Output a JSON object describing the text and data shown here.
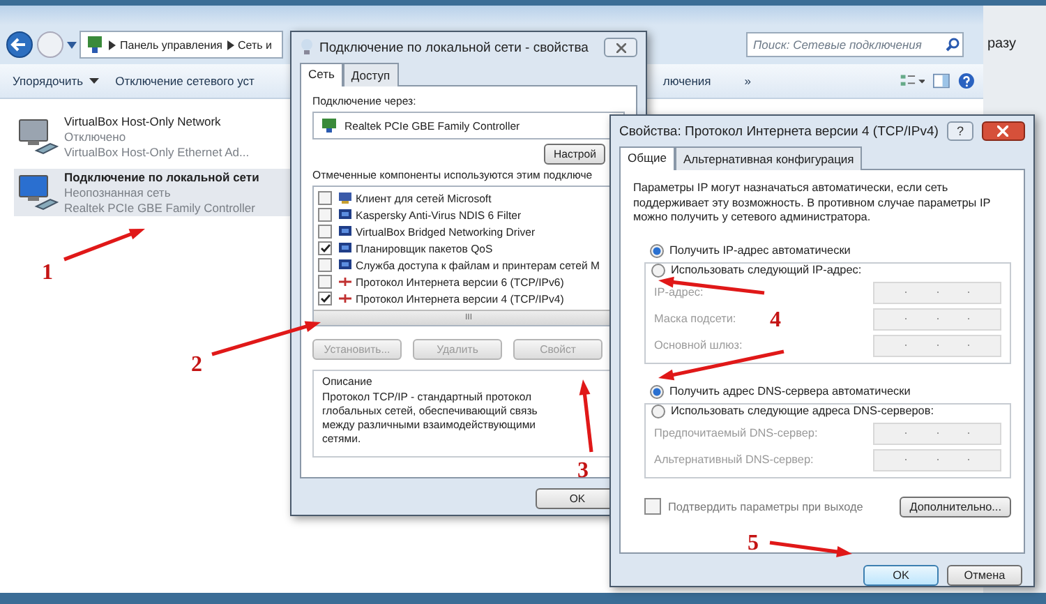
{
  "explorer": {
    "breadcrumb": [
      "Панель управления",
      "Сеть и"
    ],
    "search": {
      "placeholder": "Поиск: Сетевые подключения"
    },
    "toolbar": [
      {
        "label": "Упорядочить",
        "kind": "menu"
      },
      {
        "label": "Отключение сетевого уст",
        "kind": "plain"
      }
    ],
    "toolbar_right": "лючения",
    "toolbar_more": "»",
    "connections": [
      {
        "name": "VirtualBox Host-Only Network",
        "status": "Отключено",
        "device": "VirtualBox Host-Only Ethernet Ad...",
        "selected": false
      },
      {
        "name": "Подключение по локальной сети",
        "status": "Неопознанная сеть",
        "device": "Realtek PCIe GBE Family Controller",
        "selected": true
      }
    ]
  },
  "side_window": {
    "text": "разу"
  },
  "lan_dialog": {
    "title": "Подключение по локальной сети - свойства",
    "tabs": [
      {
        "label": "Сеть",
        "selected": true
      },
      {
        "label": "Доступ",
        "selected": false
      }
    ],
    "via_label": "Подключение через:",
    "adapter": "Realtek PCIe GBE Family Controller",
    "configure_button": "Настрой",
    "components_label": "Отмеченные компоненты используются этим подключе",
    "components": [
      {
        "label": "Клиент для сетей Microsoft",
        "checked": false,
        "kind": "client"
      },
      {
        "label": "Kaspersky Anti-Virus NDIS 6 Filter",
        "checked": false,
        "kind": "service"
      },
      {
        "label": "VirtualBox Bridged Networking Driver",
        "checked": false,
        "kind": "service"
      },
      {
        "label": "Планировщик пакетов QoS",
        "checked": true,
        "kind": "service"
      },
      {
        "label": "Служба доступа к файлам и принтерам сетей M",
        "checked": false,
        "kind": "service"
      },
      {
        "label": "Протокол Интернета версии 6 (TCP/IPv6)",
        "checked": false,
        "kind": "protocol"
      },
      {
        "label": "Протокол Интернета версии 4 (TCP/IPv4)",
        "checked": true,
        "kind": "protocol"
      }
    ],
    "scroll_grip": "III",
    "buttons": [
      {
        "label": "Установить...",
        "disabled": true
      },
      {
        "label": "Удалить",
        "disabled": true
      },
      {
        "label": "Свойст",
        "disabled": true
      }
    ],
    "description": {
      "title": "Описание",
      "text": "Протокол TCP/IP - стандартный протокол глобальных сетей, обеспечивающий связь между различными взаимодействующими сетями."
    },
    "ok_button": "OK"
  },
  "ipv4_dialog": {
    "title": "Свойства: Протокол Интернета версии 4 (TCP/IPv4)",
    "help": "?",
    "tabs": [
      {
        "label": "Общие",
        "selected": true
      },
      {
        "label": "Альтернативная конфигурация",
        "selected": false
      }
    ],
    "intro": "Параметры IP могут назначаться автоматически, если сеть поддерживает эту возможность. В противном случае параметры IP можно получить у сетевого администратора.",
    "ip_modes": [
      {
        "label": "Получить IP-адрес автоматически",
        "selected": true
      },
      {
        "label": "Использовать следующий IP-адрес:",
        "selected": false
      }
    ],
    "ip_fields": [
      {
        "label": "IP-адрес:"
      },
      {
        "label": "Маска подсети:"
      },
      {
        "label": "Основной шлюз:"
      }
    ],
    "dns_modes": [
      {
        "label": "Получить адрес DNS-сервера автоматически",
        "selected": true
      },
      {
        "label": "Использовать следующие адреса DNS-серверов:",
        "selected": false
      }
    ],
    "dns_fields": [
      {
        "label": "Предпочитаемый DNS-сервер:"
      },
      {
        "label": "Альтернативный DNS-сервер:"
      }
    ],
    "confirm": {
      "label": "Подтвердить параметры при выходе",
      "checked": false
    },
    "advanced_button": "Дополнительно...",
    "ok_button": "OK",
    "cancel_button": "Отмена"
  },
  "annotations": [
    {
      "number": "1"
    },
    {
      "number": "2"
    },
    {
      "number": "3"
    },
    {
      "number": "4"
    },
    {
      "number": "5"
    }
  ]
}
